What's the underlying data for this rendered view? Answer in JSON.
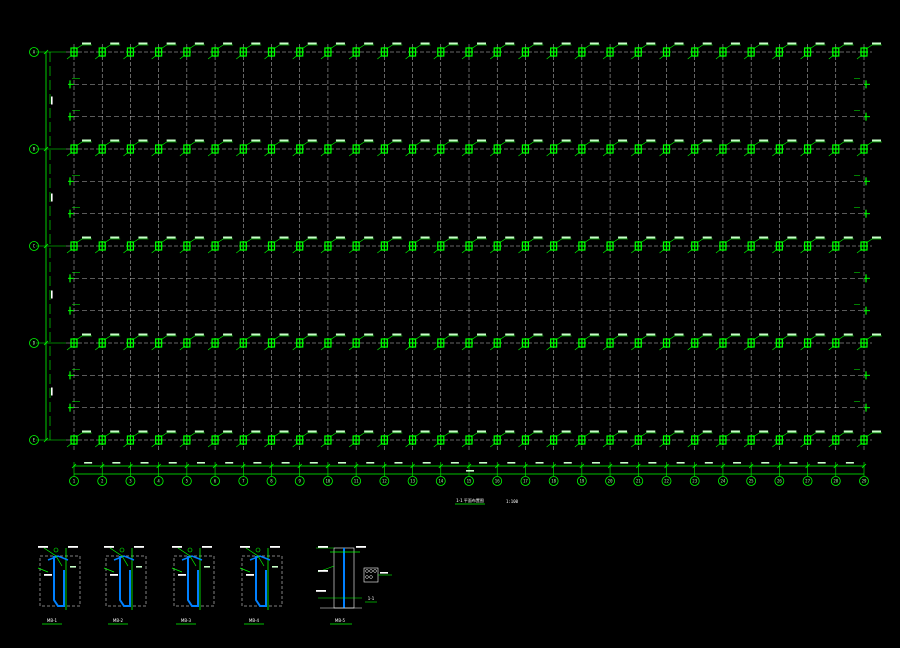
{
  "plan": {
    "columns": [
      "1",
      "2",
      "3",
      "4",
      "5",
      "6",
      "7",
      "8",
      "9",
      "10",
      "11",
      "12",
      "13",
      "14",
      "15",
      "16",
      "17",
      "18",
      "19",
      "20",
      "21",
      "22",
      "23",
      "24",
      "25",
      "26",
      "27",
      "28",
      "29"
    ],
    "rows": [
      "A",
      "B",
      "C",
      "D",
      "E"
    ],
    "title": "1-1 平面布置图",
    "scale": "1:100",
    "colors": {
      "grid": "#ffffff",
      "dim": "#00ff00",
      "anchor": "#00ff00",
      "detail": "#0080ff",
      "background": "#000000"
    }
  },
  "details": [
    {
      "name": "MB-1"
    },
    {
      "name": "MB-2"
    },
    {
      "name": "MB-3"
    },
    {
      "name": "MB-4"
    },
    {
      "name": "MB-5"
    }
  ],
  "section_label": "1-1"
}
